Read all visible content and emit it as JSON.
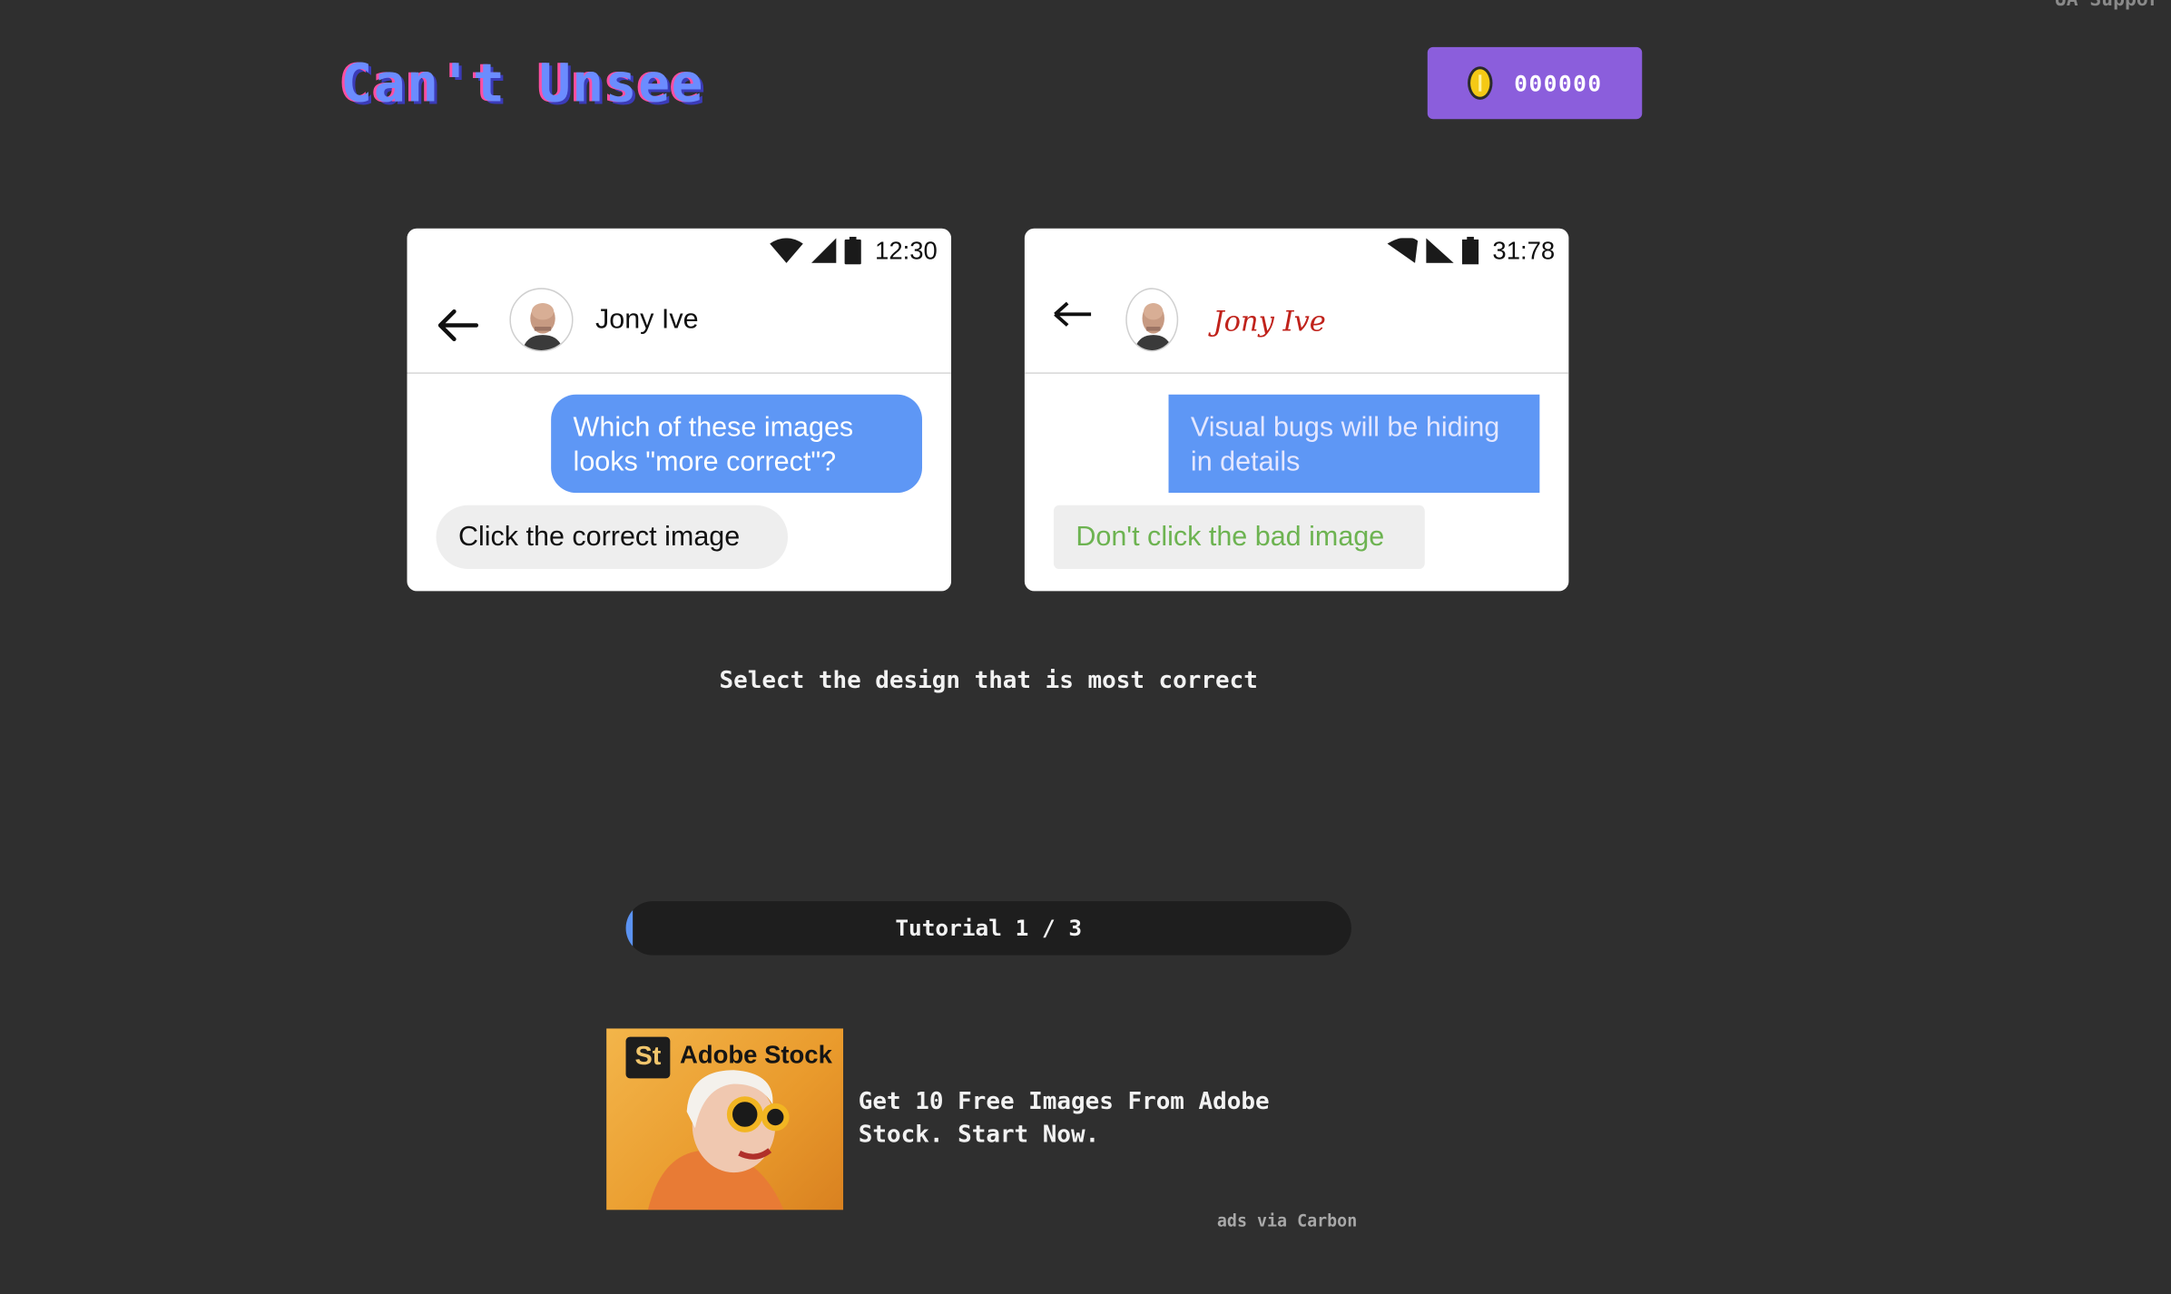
{
  "header": {
    "logo": "Can't Unsee",
    "corner_link": "UA Suppor",
    "coins": "000000"
  },
  "cards": {
    "a": {
      "time": "12:30",
      "contact_name": "Jony Ive",
      "outgoing_message": "Which of these images looks \"more correct\"?",
      "incoming_message": "Click the correct image"
    },
    "b": {
      "time": "31:78",
      "contact_name": "Jony Ive",
      "outgoing_message": "Visual bugs will be hiding in details",
      "incoming_message": "Don't click the bad image"
    }
  },
  "instruction": "Select the design that is most correct",
  "progress": {
    "label": "Tutorial 1 / 3",
    "fill_fraction": 0.01
  },
  "ad": {
    "badge": "St",
    "brand": "Adobe Stock",
    "copy": "Get 10 Free Images From Adobe Stock. Start Now.",
    "via": "ads via Carbon"
  },
  "colors": {
    "background": "#2f2f2f",
    "coin_box": "#8b5edc",
    "outgoing_bubble": "#5e97f5",
    "progress_fill": "#5b93f2",
    "card_b_name": "#c0221b",
    "card_b_incoming_text": "#6db351"
  },
  "icons": {
    "wifi": "wifi-icon",
    "signal": "signal-icon",
    "battery": "battery-icon",
    "back": "back-arrow-icon",
    "coin": "coin-icon"
  }
}
